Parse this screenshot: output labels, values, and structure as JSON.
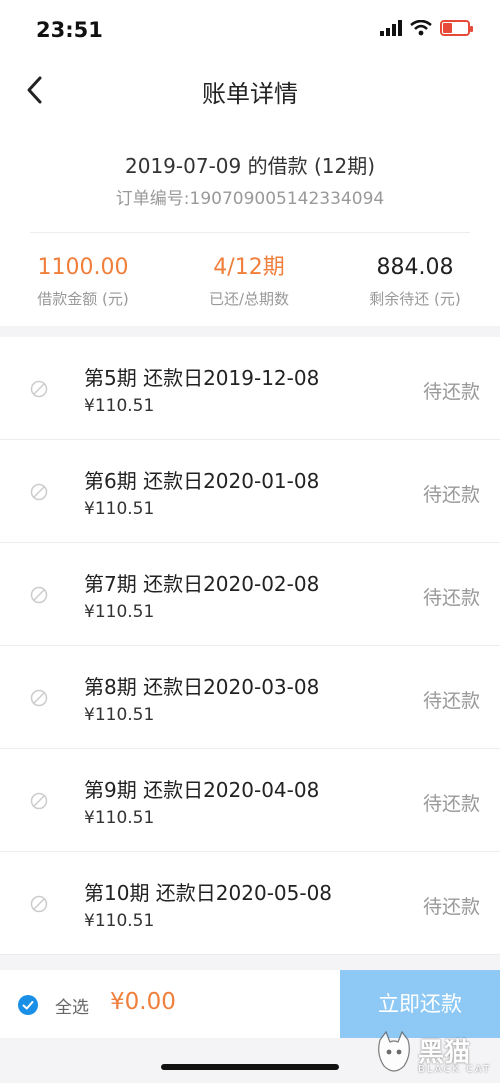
{
  "status_bar": {
    "time": "23:51"
  },
  "header": {
    "title": "账单详情"
  },
  "loan": {
    "title": "2019-07-09 的借款 (12期)",
    "order_number": "订单编号:190709005142334094"
  },
  "stats": [
    {
      "value": "1100.00",
      "label": "借款金额 (元)",
      "highlight": true
    },
    {
      "value": "4/12期",
      "label": "已还/总期数",
      "highlight": true
    },
    {
      "value": "884.08",
      "label": "剩余待还 (元)",
      "highlight": false
    }
  ],
  "installments": [
    {
      "title": "第5期 还款日2019-12-08",
      "amount": "¥110.51",
      "status": "待还款"
    },
    {
      "title": "第6期 还款日2020-01-08",
      "amount": "¥110.51",
      "status": "待还款"
    },
    {
      "title": "第7期 还款日2020-02-08",
      "amount": "¥110.51",
      "status": "待还款"
    },
    {
      "title": "第8期 还款日2020-03-08",
      "amount": "¥110.51",
      "status": "待还款"
    },
    {
      "title": "第9期 还款日2020-04-08",
      "amount": "¥110.51",
      "status": "待还款"
    },
    {
      "title": "第10期 还款日2020-05-08",
      "amount": "¥110.51",
      "status": "待还款"
    }
  ],
  "footer": {
    "select_all_label": "全选",
    "total": "¥0.00",
    "pay_label": "立即还款"
  },
  "watermark": {
    "zh": "黑猫",
    "en": "BLACK CAT"
  },
  "colors": {
    "accent_orange": "#f07f3c",
    "accent_blue": "#1a8fe6",
    "pay_button": "#8dc9f4"
  },
  "icons": [
    "back-arrow-icon",
    "signal-icon",
    "wifi-icon",
    "battery-icon",
    "disabled-check-icon",
    "checkmark-icon"
  ]
}
